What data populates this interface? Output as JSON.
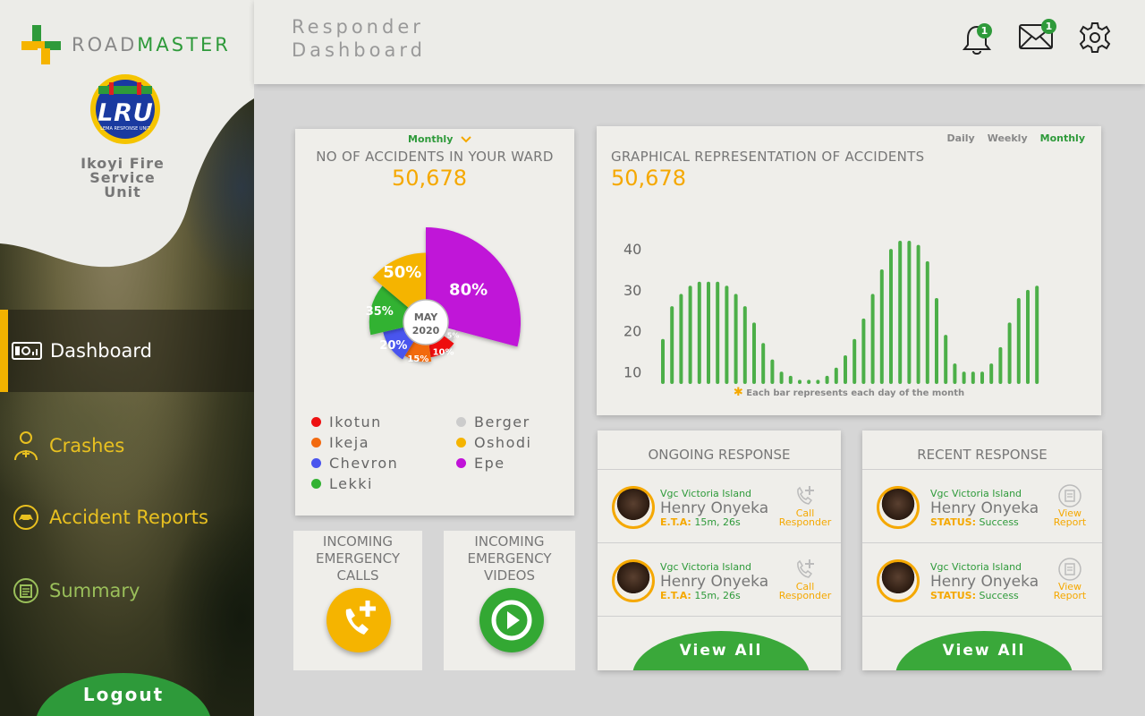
{
  "brand": {
    "name_part1": "ROAD",
    "name_part2": "MASTER"
  },
  "unit": {
    "logo_text": "LRU",
    "logo_subtitle": "LEMA RESPONSE UNIT",
    "name": "Ikoyi Fire\nService\nUnit"
  },
  "nav": [
    {
      "label": "Dashboard",
      "icon": "dashboard-icon",
      "active": true
    },
    {
      "label": "Crashes",
      "icon": "responder-icon"
    },
    {
      "label": "Accident Reports",
      "icon": "car-crash-icon"
    },
    {
      "label": "Summary",
      "icon": "summary-icon"
    }
  ],
  "logout_label": "Logout",
  "header": {
    "title": "Responder\nDashboard",
    "notifications_count": "1",
    "messages_count": "1"
  },
  "ward_card": {
    "period": "Monthly",
    "title": "NO OF ACCIDENTS IN YOUR WARD",
    "total": "50,678",
    "center_label_month": "MAY",
    "center_label_year": "2020"
  },
  "graph_card": {
    "tabs": [
      "Daily",
      "Weekly",
      "Monthly"
    ],
    "active_tab": "Monthly",
    "title": "GRAPHICAL REPRESENTATION OF ACCIDENTS",
    "total": "50,678",
    "footnote": "Each bar represents each day of the month"
  },
  "chart_data": [
    {
      "type": "pie",
      "categories": [
        "Ikotun",
        "Ikeja",
        "Chevron",
        "Lekki",
        "Berger",
        "Oshodi",
        "Epe"
      ],
      "values": [
        10,
        15,
        20,
        35,
        5,
        50,
        80
      ],
      "labels": [
        "10%",
        "15%",
        "20%",
        "35%",
        "5%",
        "50%",
        "80%"
      ],
      "colors": {
        "Ikotun": "#ee1111",
        "Ikeja": "#f26a10",
        "Chevron": "#4a55ee",
        "Lekki": "#33b233",
        "Berger": "#cccccc",
        "Oshodi": "#f5b400",
        "Epe": "#c012d8"
      }
    },
    {
      "type": "bar",
      "yticks": [
        10,
        20,
        30,
        40
      ],
      "ylim": [
        7,
        42
      ],
      "color": "#4caf48",
      "values": [
        18,
        26,
        29,
        31,
        32,
        32,
        32,
        31,
        29,
        26,
        22,
        17,
        13,
        10,
        9,
        8,
        8,
        8,
        9,
        11,
        14,
        18,
        23,
        29,
        35,
        40,
        42,
        42,
        41,
        37,
        28,
        19,
        12,
        10,
        10,
        10,
        12,
        16,
        22,
        28,
        30,
        31
      ]
    }
  ],
  "ongoing": {
    "title": "ONGOING RESPONSE",
    "rows": [
      {
        "location": "Vgc Victoria Island",
        "name": "Henry Onyeka",
        "meta_label": "E.T.A:",
        "meta_value": "15m, 26s",
        "action": "Call\nResponder"
      },
      {
        "location": "Vgc Victoria Island",
        "name": "Henry Onyeka",
        "meta_label": "E.T.A:",
        "meta_value": "15m, 26s",
        "action": "Call\nResponder"
      }
    ],
    "view_all": "View All"
  },
  "recent": {
    "title": "RECENT RESPONSE",
    "rows": [
      {
        "location": "Vgc Victoria Island",
        "name": "Henry Onyeka",
        "meta_label": "STATUS:",
        "meta_value": "Success",
        "action": "View\nReport"
      },
      {
        "location": "Vgc Victoria Island",
        "name": "Henry Onyeka",
        "meta_label": "STATUS:",
        "meta_value": "Success",
        "action": "View\nReport"
      }
    ],
    "view_all": "View All"
  },
  "incoming_calls": {
    "label": "INCOMING\nEMERGENCY\nCALLS"
  },
  "incoming_videos": {
    "label": "INCOMING\nEMERGENCY\nVIDEOS"
  },
  "colors": {
    "accent": "#f5a800",
    "brand_green": "#2e9a3a",
    "bar_green": "#4caf48"
  }
}
